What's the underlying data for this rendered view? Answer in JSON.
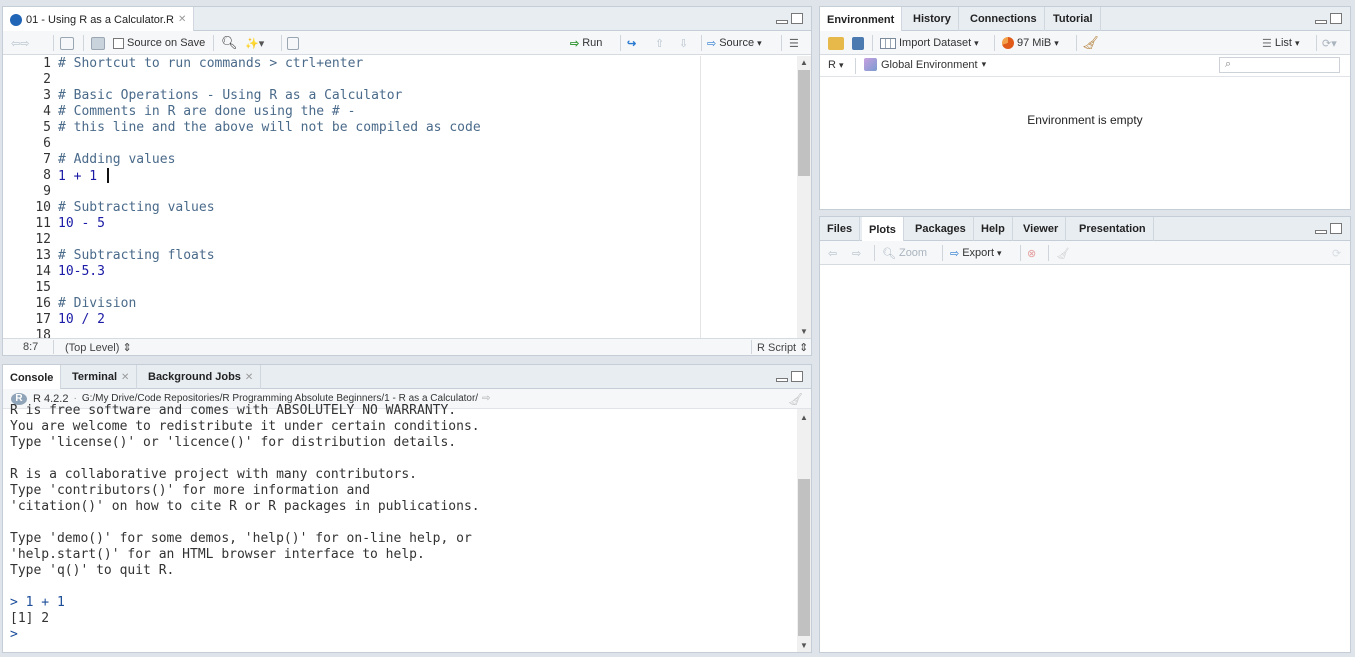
{
  "source": {
    "tab_label": "01 - Using R as a Calculator.R",
    "source_on_save": "Source on Save",
    "run": "Run",
    "source_btn": "Source",
    "line_numbers": [
      "1",
      "2",
      "3",
      "4",
      "5",
      "6",
      "7",
      "8",
      "9",
      "10",
      "11",
      "12",
      "13",
      "14",
      "15",
      "16",
      "17",
      "18"
    ],
    "lines": [
      {
        "text": "# Shortcut to run commands > ctrl+enter",
        "kind": "cm"
      },
      {
        "text": "",
        "kind": "cm"
      },
      {
        "text": "# Basic Operations - Using R as a Calculator",
        "kind": "cm"
      },
      {
        "text": "# Comments in R are done using the # -",
        "kind": "cm"
      },
      {
        "text": "# this line and the above will not be compiled as code",
        "kind": "cm"
      },
      {
        "text": "",
        "kind": "cm"
      },
      {
        "text": "# Adding values",
        "kind": "cm"
      },
      {
        "text": "1 + 1 ",
        "kind": "num"
      },
      {
        "text": "",
        "kind": "cm"
      },
      {
        "text": "# Subtracting values",
        "kind": "cm"
      },
      {
        "text": "10 - 5",
        "kind": "num"
      },
      {
        "text": "",
        "kind": "cm"
      },
      {
        "text": "# Subtracting floats",
        "kind": "cm"
      },
      {
        "text": "10-5.3",
        "kind": "num"
      },
      {
        "text": "",
        "kind": "cm"
      },
      {
        "text": "# Division",
        "kind": "cm"
      },
      {
        "text": "10 / 2",
        "kind": "num"
      },
      {
        "text": "",
        "kind": "cm"
      }
    ],
    "cursor_pos": "8:7",
    "scope": "(Top Level)",
    "file_type": "R Script"
  },
  "console": {
    "tabs": [
      "Console",
      "Terminal",
      "Background Jobs"
    ],
    "r_version": "R 4.2.2",
    "path": "G:/My Drive/Code Repositories/R Programming Absolute Beginners/1 - R as a Calculator/",
    "output": [
      "R is free software and comes with ABSOLUTELY NO WARRANTY.",
      "You are welcome to redistribute it under certain conditions.",
      "Type 'license()' or 'licence()' for distribution details.",
      "",
      "R is a collaborative project with many contributors.",
      "Type 'contributors()' for more information and",
      "'citation()' on how to cite R or R packages in publications.",
      "",
      "Type 'demo()' for some demos, 'help()' for on-line help, or",
      "'help.start()' for an HTML browser interface to help.",
      "Type 'q()' to quit R.",
      "",
      "> 1 + 1",
      "[1] 2",
      "> "
    ]
  },
  "environment": {
    "tabs": [
      "Environment",
      "History",
      "Connections",
      "Tutorial"
    ],
    "import_dataset": "Import Dataset",
    "memory": "97 MiB",
    "list_view": "List",
    "language": "R",
    "scope": "Global Environment",
    "empty_message": "Environment is empty"
  },
  "files": {
    "tabs": [
      "Files",
      "Plots",
      "Packages",
      "Help",
      "Viewer",
      "Presentation"
    ],
    "zoom": "Zoom",
    "export": "Export"
  },
  "colors": {
    "accent": "#4a6a8a",
    "number": "#1a1aa6",
    "run_green": "#3a9a3a"
  }
}
